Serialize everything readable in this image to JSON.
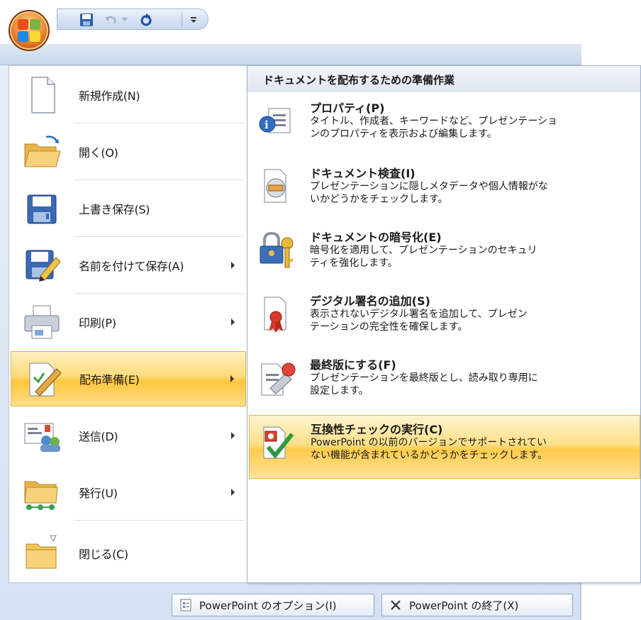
{
  "quick_access_toolbar": {
    "icons": [
      "office-button-icon",
      "save-icon",
      "undo-icon",
      "redo-icon",
      "customize-dropdown-icon"
    ]
  },
  "left_menu": {
    "items": [
      {
        "label": "新規作成(N)",
        "icon": "new-document-icon",
        "has_submenu": false
      },
      {
        "label": "開く(O)",
        "icon": "open-folder-icon",
        "has_submenu": false
      },
      {
        "label": "上書き保存(S)",
        "icon": "save-icon",
        "has_submenu": false
      },
      {
        "label": "名前を付けて保存(A)",
        "icon": "save-as-icon",
        "has_submenu": true
      },
      {
        "label": "印刷(P)",
        "icon": "print-icon",
        "has_submenu": true
      },
      {
        "label": "配布準備(E)",
        "icon": "prepare-icon",
        "has_submenu": true,
        "selected": true
      },
      {
        "label": "送信(D)",
        "icon": "send-icon",
        "has_submenu": true
      },
      {
        "label": "発行(U)",
        "icon": "publish-icon",
        "has_submenu": true
      },
      {
        "label": "閉じる(C)",
        "icon": "close-folder-icon",
        "has_submenu": false
      }
    ]
  },
  "submenu": {
    "header": "ドキュメントを配布するための準備作業",
    "items": [
      {
        "title": "プロパティ(P)",
        "desc1": "タイトル、作成者、キーワードなど、プレゼンテーショ",
        "desc2": "ンのプロパティを表示および編集します。",
        "icon": "properties-icon"
      },
      {
        "title": "ドキュメント検査(I)",
        "desc1": "プレゼンテーションに隠しメタデータや個人情報がな",
        "desc2": "いかどうかをチェックします。",
        "icon": "inspect-document-icon"
      },
      {
        "title": "ドキュメントの暗号化(E)",
        "desc1": "暗号化を適用して、プレゼンテーションのセキュリ",
        "desc2": "ティを強化します。",
        "icon": "encrypt-lock-icon"
      },
      {
        "title": "デジタル署名の追加(S)",
        "desc1": "表示されないデジタル署名を追加して、プレゼン",
        "desc2": "テーションの完全性を確保します。",
        "icon": "digital-signature-icon"
      },
      {
        "title": "最終版にする(F)",
        "desc1": "プレゼンテーションを最終版とし、読み取り専用に",
        "desc2": "設定します。",
        "icon": "mark-final-icon"
      },
      {
        "title": "互換性チェックの実行(C)",
        "desc1": "PowerPoint の以前のバージョンでサポートされてい",
        "desc2": "ない機能が含まれているかどうかをチェックします。",
        "icon": "compatibility-check-icon",
        "selected": true
      }
    ]
  },
  "bottom": {
    "options_label": "PowerPoint のオプション(I)",
    "exit_label": "PowerPoint の終了(X)"
  },
  "colors": {
    "highlight": "#ffc63d",
    "frame": "#d6e2f2",
    "office_button": "#d9661a"
  }
}
